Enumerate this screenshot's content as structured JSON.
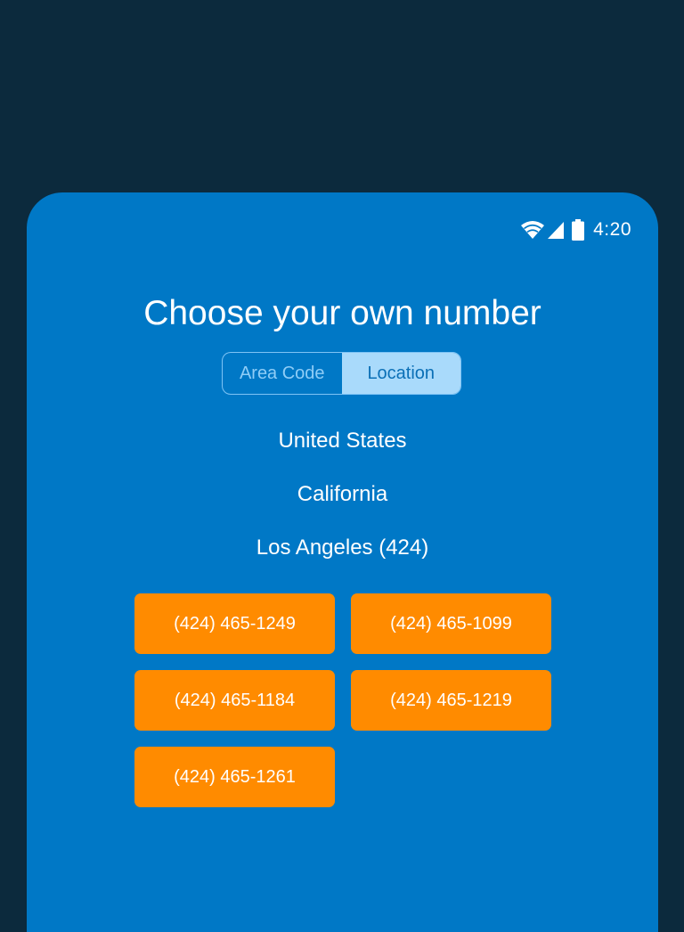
{
  "status_bar": {
    "time": "4:20",
    "icons": [
      "wifi-icon",
      "signal-icon",
      "battery-icon"
    ]
  },
  "page": {
    "title": "Choose your own number"
  },
  "segmented_control": {
    "options": [
      {
        "label": "Area Code",
        "selected": false
      },
      {
        "label": "Location",
        "selected": true
      }
    ]
  },
  "location": {
    "country": "United States",
    "state": "California",
    "city": "Los Angeles (424)"
  },
  "numbers": [
    "(424) 465-1249",
    "(424) 465-1099",
    "(424) 465-1184",
    "(424) 465-1219",
    "(424) 465-1261"
  ],
  "colors": {
    "background": "#0c2a3d",
    "screen": "#0078c6",
    "accent": "#ff8b00",
    "segment_selected": "#a9dafb"
  }
}
